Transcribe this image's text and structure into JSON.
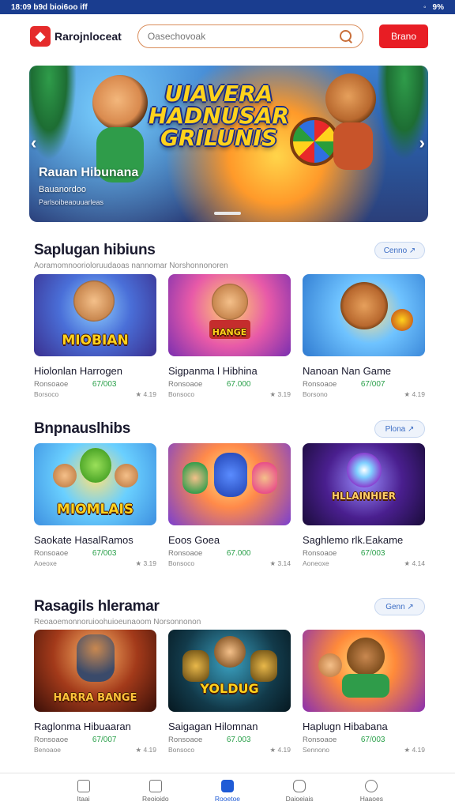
{
  "statusbar": {
    "time": "18:09 b9d bioi6oo iff",
    "battery": "9%"
  },
  "header": {
    "brand": "Rarojnloceat",
    "search_placeholder": "Oasechovoak",
    "cta": "Brano"
  },
  "banner": {
    "title": "UIAVERA HADNUSAR GRILUNIS",
    "name": "Rauan Hibunana",
    "sub1": "Bauanordoo",
    "sub2": "Parlsoibeaouuarleas"
  },
  "sections": [
    {
      "title": "Saplugan hibiuns",
      "subtitle": "Aoramomnoorioloruudaoas nannomar Norshonnonoren",
      "more": "Cenno ↗",
      "cards": [
        {
          "thumb": "MIOBIAN",
          "name": "Hiolonlan Harrogen",
          "l1": "Ronsoaoe",
          "price": "67/003",
          "l2": "Borsoco",
          "r2": "★ 4.19"
        },
        {
          "thumb": "HANGE",
          "name": "Sigpanma l Hibhina",
          "l1": "Ronsoaoe",
          "price": "67.000",
          "l2": "Bonsoco",
          "r2": "★ 3.19"
        },
        {
          "thumb": "",
          "name": "Nanoan Nan Game",
          "l1": "Ronsoaoe",
          "price": "67/007",
          "l2": "Borsono",
          "r2": "★ 4.19"
        }
      ]
    },
    {
      "title": "Bnpnauslhibs",
      "subtitle": "",
      "more": "Plona ↗",
      "cards": [
        {
          "thumb": "MIOMLAIS",
          "name": "Saokate HasalRamos",
          "l1": "Ronsoaoe",
          "price": "67/003",
          "l2": "Aoeoxe",
          "r2": "★ 3.19"
        },
        {
          "thumb": "",
          "name": "Eoos Goea",
          "l1": "Ronsoaoe",
          "price": "67.000",
          "l2": "Bonsoco",
          "r2": "★ 3.14"
        },
        {
          "thumb": "HLLAINHIER",
          "name": "Saghlemo rlk.Eakame",
          "l1": "Ronsoaoe",
          "price": "67/003",
          "l2": "Aoneoxe",
          "r2": "★ 4.14"
        }
      ]
    },
    {
      "title": "Rasagils hleramar",
      "subtitle": "Reoaoemonnoruioohuioeunaoom Norsonnonon",
      "more": "Genn ↗",
      "cards": [
        {
          "thumb": "HARRA BANGE",
          "name": "Raglonma Hibuaaran",
          "l1": "Ronsoaoe",
          "price": "67/007",
          "l2": "Benoaoe",
          "r2": "★ 4.19"
        },
        {
          "thumb": "YOLDUG",
          "name": "Saigagan Hilomnan",
          "l1": "Ronsoaoe",
          "price": "67.003",
          "l2": "Bonsoco",
          "r2": "★ 4.19"
        },
        {
          "thumb": "",
          "name": "Haplugn Hibabana",
          "l1": "Ronsoaoe",
          "price": "67/003",
          "l2": "Sennono",
          "r2": "★ 4.19"
        }
      ]
    }
  ],
  "nav": [
    {
      "label": "Itaai",
      "icon": "home-icon"
    },
    {
      "label": "Reoioido",
      "icon": "list-icon"
    },
    {
      "label": "Rooetoe",
      "icon": "games-icon",
      "active": true
    },
    {
      "label": "Daioeiais",
      "icon": "bag-icon"
    },
    {
      "label": "Haaoes",
      "icon": "profile-icon"
    }
  ],
  "colors": {
    "brand": "#e81d24",
    "accent": "#1f5bd6",
    "price": "#2aa04a"
  }
}
